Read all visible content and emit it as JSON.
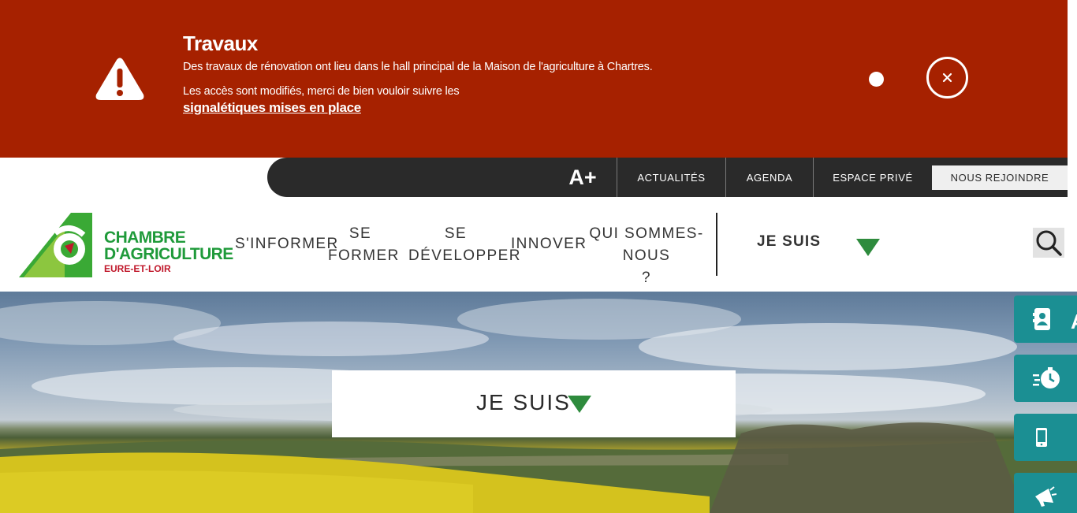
{
  "alert": {
    "icon": "warning-triangle-icon",
    "title": "Travaux",
    "line1": "Des travaux de rénovation ont lieu dans le hall principal de la Maison de l'agriculture à Chartres.",
    "line2": "Les accès sont modifiés, merci de bien vouloir suivre les",
    "link": "signalétiques mises en place",
    "close_icon": "close-icon",
    "color": "#a62100"
  },
  "utility_bar": {
    "font_size_label": "A+",
    "links": [
      "ACTUALITÉS",
      "AGENDA",
      "ESPACE PRIVÉ"
    ],
    "join_label": "NOUS REJOINDRE",
    "color": "#2a2a2a"
  },
  "logo": {
    "line1": "CHAMBRE",
    "line2": "D'AGRICULTURE",
    "line3": "EURE-ET-LOIR",
    "green": "#1f9a3a",
    "red": "#c0182b"
  },
  "nav": {
    "items": [
      {
        "line1": "S'INFORMER",
        "line2": ""
      },
      {
        "line1": "SE",
        "line2": "FORMER"
      },
      {
        "line1": "SE",
        "line2": "DÉVELOPPER"
      },
      {
        "line1": "INNOVER",
        "line2": ""
      },
      {
        "line1": "QUI SOMMES-NOUS",
        "line2": "?"
      }
    ],
    "je_suis": "JE SUIS",
    "search_icon": "search-icon"
  },
  "hero": {
    "je_suis_label": "JE SUIS",
    "accent": "#2e8b3d"
  },
  "side_buttons": [
    {
      "icon": "contact-card-icon",
      "partial_text": "A"
    },
    {
      "icon": "fast-clock-icon"
    },
    {
      "icon": "mobile-phone-icon"
    },
    {
      "icon": "megaphone-icon"
    }
  ],
  "side_color": "#1b8f93"
}
